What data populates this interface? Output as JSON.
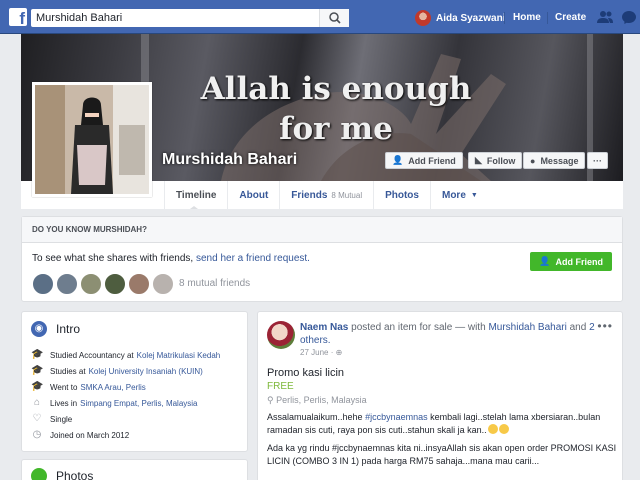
{
  "topbar": {
    "logo": "f",
    "search_value": "Murshidah Bahari",
    "user_name": "Aida Syazwani",
    "home": "Home",
    "create": "Create"
  },
  "cover": {
    "quote_line1": "Allah is enough",
    "quote_line2": "for me",
    "name": "Murshidah Bahari",
    "add_friend": "Add Friend",
    "follow": "Follow",
    "message": "Message",
    "more": "···"
  },
  "tabs": [
    {
      "label": "Timeline"
    },
    {
      "label": "About"
    },
    {
      "label": "Friends",
      "sub": "8 Mutual"
    },
    {
      "label": "Photos"
    },
    {
      "label": "More"
    }
  ],
  "know": {
    "heading": "DO YOU KNOW MURSHIDAH?",
    "text": "To see what she shares with friends, ",
    "link": "send her a friend request.",
    "button": "Add Friend",
    "mutual": "8 mutual friends"
  },
  "intro": {
    "title": "Intro",
    "rows": [
      {
        "prefix": "Studied Accountancy at",
        "link": "Kolej Matrikulasi Kedah"
      },
      {
        "prefix": "Studies at",
        "link": "Kolej University Insaniah (KUIN)"
      },
      {
        "prefix": "Went to",
        "link": "SMKA Arau, Perlis"
      },
      {
        "prefix": "Lives in",
        "link": "Simpang Empat, Perlis, Malaysia"
      },
      {
        "prefix": "Single",
        "link": ""
      },
      {
        "prefix": "Joined on March 2012",
        "link": ""
      }
    ]
  },
  "photos": {
    "title": "Photos"
  },
  "post": {
    "author": "Naem Nas",
    "action": " posted an item for sale — with ",
    "tagged": "Murshidah Bahari",
    "and": " and ",
    "others": "2 others.",
    "date": "27 June",
    "item_title": "Promo kasi licin",
    "price": "FREE",
    "location": "Perlis, Perlis, Malaysia",
    "para1_a": "Assalamualaikum..hehe ",
    "para1_tag": "#jccbynaemnas",
    "para1_b": " kembali lagi..stelah lama xbersiaran..bulan ramadan sis cuti, raya pon sis cuti..stahun skali ja kan..",
    "para2": "Ada ka yg rindu #jccbynaemnas kita ni..insyaAllah sis akan open order PROMOSI KASI LICIN (COMBO 3 IN 1) pada harga RM75 sahaja...mana mau carii..."
  }
}
